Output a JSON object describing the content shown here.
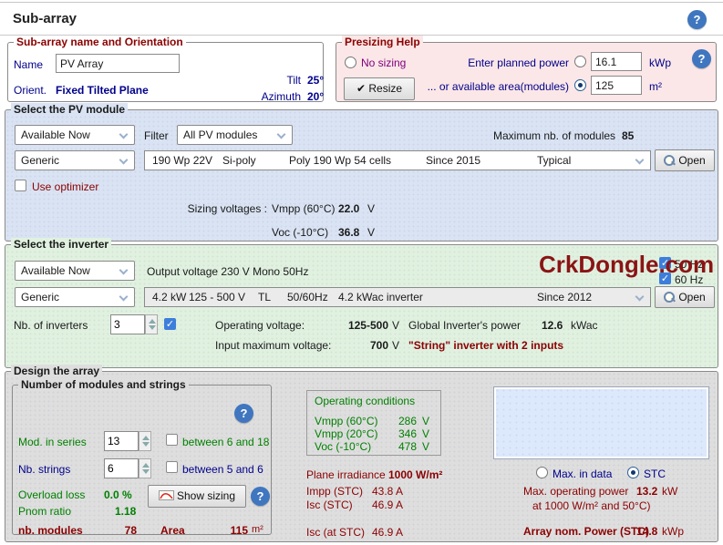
{
  "header": {
    "title": "Sub-array"
  },
  "orientation": {
    "legend": "Sub-array name and Orientation",
    "name_label": "Name",
    "name_value": "PV Array",
    "orient_label": "Orient.",
    "orient_value": "Fixed Tilted Plane",
    "tilt_label": "Tilt",
    "tilt_value": "25°",
    "azimuth_label": "Azimuth",
    "azimuth_value": "20°"
  },
  "presizing": {
    "legend": "Presizing Help",
    "no_sizing_label": "No sizing",
    "planned_power_label": "Enter planned power",
    "planned_power_value": "16.1",
    "planned_power_unit": "kWp",
    "area_label": "... or available area(modules)",
    "area_value": "125",
    "area_unit": "m²",
    "resize_check": "✔",
    "resize_label": "Resize"
  },
  "pv_module": {
    "legend": "Select the PV module",
    "availability": "Available Now",
    "filter_label": "Filter",
    "filter_value": "All PV modules",
    "max_modules_label": "Maximum nb. of modules",
    "max_modules_value": "85",
    "manufacturer": "Generic",
    "module": {
      "power": "190 Wp 22V",
      "tech": "Si-poly",
      "desc": "Poly 190 Wp  54 cells",
      "since": "Since 2015",
      "note": "Typical"
    },
    "open_label": "Open",
    "use_optimizer_label": "Use optimizer",
    "sizing_label": "Sizing voltages :",
    "vmpp_label": "Vmpp (60°C)",
    "vmpp_value": "22.0",
    "vmpp_unit": "V",
    "voc_label": "Voc (-10°C)",
    "voc_value": "36.8",
    "voc_unit": "V"
  },
  "inverter": {
    "legend": "Select the inverter",
    "availability": "Available Now",
    "output_voltage": "Output voltage 230 V Mono 50Hz",
    "watermark": "CrkDongle.com",
    "freq50_label": "50 Hz",
    "freq60_label": "60 Hz",
    "check_glyph": "✓",
    "manufacturer": "Generic",
    "model": {
      "power": "4.2 kW",
      "voltage": "125 - 500 V",
      "type": "TL",
      "freq": "50/60Hz",
      "desc": "4.2 kWac inverter",
      "since": "Since 2012"
    },
    "open_label": "Open",
    "nb_label": "Nb. of inverters",
    "nb_value": "3",
    "operating_voltage_label": "Operating voltage:",
    "operating_voltage_value": "125-500",
    "operating_voltage_unit": "V",
    "global_power_label": "Global Inverter's power",
    "global_power_value": "12.6",
    "global_power_unit": "kWac",
    "input_max_label": "Input maximum voltage:",
    "input_max_value": "700",
    "input_max_unit": "V",
    "string_note": "\"String\" inverter with 2 inputs"
  },
  "design": {
    "legend": "Design the array",
    "modules_strings": {
      "legend": "Number of modules and strings",
      "mod_series_label": "Mod. in series",
      "mod_series_value": "13",
      "mod_series_hint": "between 6 and 18",
      "nb_strings_label": "Nb. strings",
      "nb_strings_value": "6",
      "nb_strings_hint": "between 5 and 6",
      "overload_label": "Overload loss",
      "overload_value": "0.0 %",
      "pnom_label": "Pnom ratio",
      "pnom_value": "1.18",
      "show_sizing_label": "Show sizing",
      "nb_modules_label": "nb. modules",
      "nb_modules_value": "78",
      "area_label": "Area",
      "area_value": "115",
      "area_unit": "m²"
    },
    "operating_conditions": {
      "legend": "Operating conditions",
      "rows": [
        {
          "label": "Vmpp (60°C)",
          "value": "286",
          "unit": "V"
        },
        {
          "label": "Vmpp (20°C)",
          "value": "346",
          "unit": "V"
        },
        {
          "label": "Voc (-10°C)",
          "value": "478",
          "unit": "V"
        }
      ]
    },
    "irradiance": {
      "plane_label": "Plane irradiance",
      "plane_value": "1000 W/m²",
      "impp_label": "Impp (STC)",
      "impp_value": "43.8 A",
      "isc_label": "Isc (STC)",
      "isc_value": "46.9 A",
      "isc_stc_label": "Isc (at STC)",
      "isc_stc_value": "46.9 A"
    },
    "stc": {
      "max_in_data_label": "Max. in data",
      "stc_label": "STC",
      "max_power_label": "Max. operating power",
      "max_power_value": "13.2",
      "max_power_unit": "kW",
      "max_power_cond": "at 1000 W/m²  and 50°C)",
      "array_power_label": "Array nom. Power (STC)",
      "array_power_value": "14.8",
      "array_power_unit": "kWp"
    }
  }
}
